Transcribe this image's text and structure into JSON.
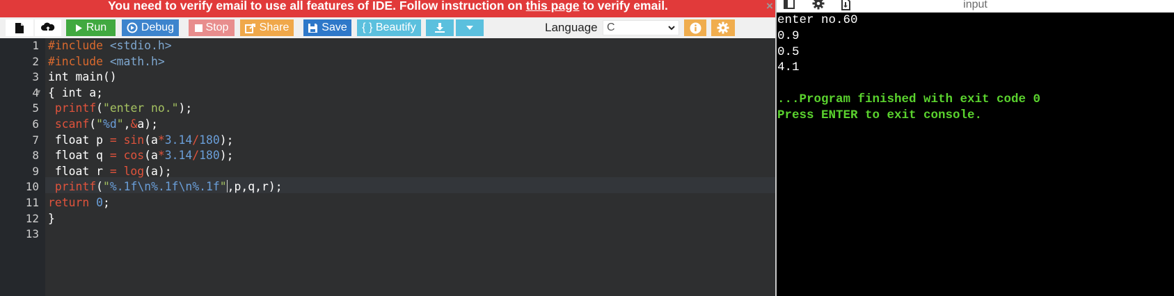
{
  "banner": {
    "text_before": "You need to verify email to use all features of IDE. Follow instruction on ",
    "link": "this page",
    "text_after": " to verify email.",
    "close": "×"
  },
  "toolbar": {
    "run": "Run",
    "debug": "Debug",
    "stop": "Stop",
    "share": "Share",
    "save": "Save",
    "beautify": "{ } Beautify",
    "language_label": "Language",
    "language_value": "C"
  },
  "editor": {
    "line_numbers": [
      "1",
      "2",
      "3",
      "4",
      "5",
      "6",
      "7",
      "8",
      "9",
      "10",
      "11",
      "12",
      "13"
    ],
    "code_lines": [
      "#include <stdio.h>",
      "#include <math.h>",
      "int main()",
      "{ int a;",
      " printf(\"enter no.\");",
      " scanf(\"%d\",&a);",
      " float p = sin(a*3.14/180);",
      " float q = cos(a*3.14/180);",
      " float r = log(a);",
      " printf(\"%.1f\\n%.1f\\n%.1f\",p,q,r);",
      "return 0;",
      "}",
      ""
    ],
    "active_line": 10
  },
  "console": {
    "header_title": "input",
    "output_lines": [
      "enter no.60",
      "0.9",
      "0.5",
      "4.1",
      ""
    ],
    "exit_lines": [
      "...Program finished with exit code 0",
      "Press ENTER to exit console."
    ]
  },
  "colors": {
    "banner_bg": "#e13a3a",
    "run": "#41a940",
    "debug": "#3d84cd",
    "stop": "#e88d8d",
    "share": "#f0a84a",
    "save": "#2e78c9",
    "beautify": "#5bc0de",
    "download": "#5bc0de",
    "info": "#f0ad4e",
    "settings": "#f0ad4e",
    "console_green": "#5ad22e"
  },
  "icons": {
    "new_file": "file-icon",
    "upload": "cloud-upload-icon",
    "run": "play-icon",
    "debug": "debug-circle-icon",
    "stop": "stop-square-icon",
    "share": "share-icon",
    "save": "floppy-disk-icon",
    "download": "download-icon",
    "more": "caret-down-icon",
    "info": "info-icon",
    "settings": "gear-icon",
    "header_left": "layout-icon",
    "header_gear": "gear-icon",
    "header_download": "download-file-icon"
  }
}
